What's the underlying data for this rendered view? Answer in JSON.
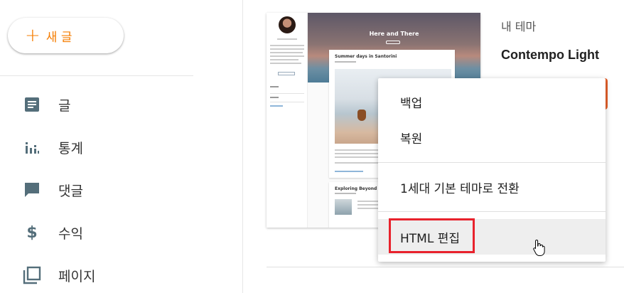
{
  "sidebar": {
    "new_post_label": "새 글",
    "items": [
      {
        "label": "글",
        "icon": "posts-icon"
      },
      {
        "label": "통계",
        "icon": "stats-icon"
      },
      {
        "label": "댓글",
        "icon": "comments-icon"
      },
      {
        "label": "수익",
        "icon": "earnings-icon"
      },
      {
        "label": "페이지",
        "icon": "pages-icon"
      }
    ]
  },
  "theme": {
    "section_label": "내 테마",
    "name": "Contempo Light",
    "preview": {
      "blog_title": "Here and There",
      "post1_title": "Summer days in Santorini",
      "post2_title": "Exploring Beyond the C"
    }
  },
  "menu": {
    "items": [
      "백업",
      "복원",
      "1세대 기본 테마로 전환",
      "HTML 편집"
    ]
  },
  "colors": {
    "accent": "#f57c00",
    "highlight_box": "#e8222c",
    "icon": "#546e7a"
  }
}
